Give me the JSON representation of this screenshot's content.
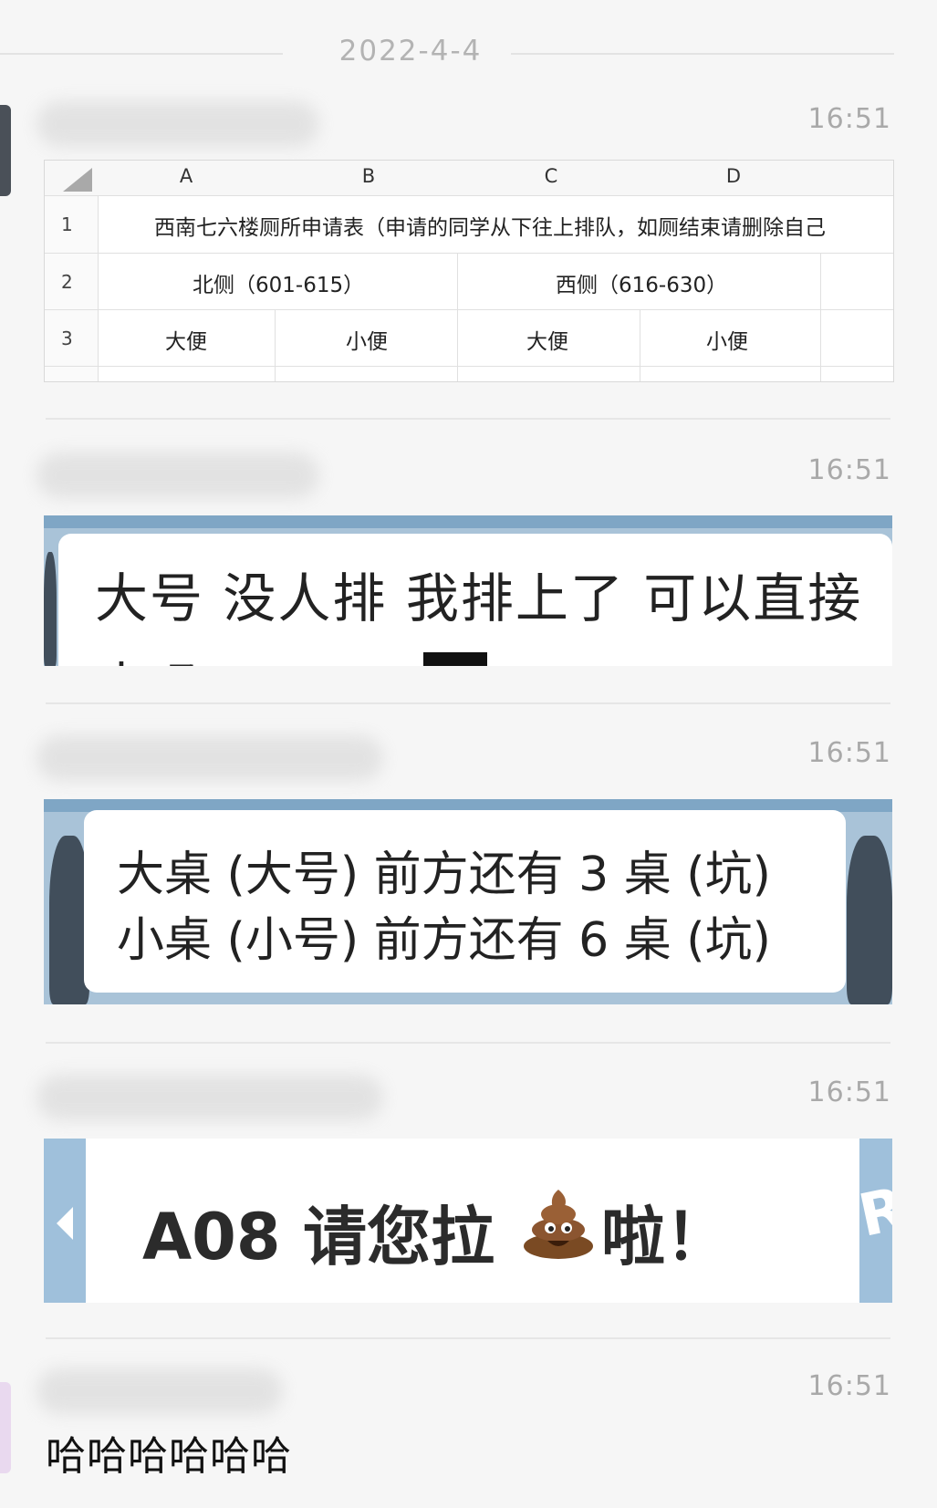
{
  "chat": {
    "date": "2022-4-4",
    "messages": [
      {
        "time": "16:51",
        "type": "image-spreadsheet"
      },
      {
        "time": "16:51",
        "type": "image-screenshot"
      },
      {
        "time": "16:51",
        "type": "image-screenshot"
      },
      {
        "time": "16:51",
        "type": "image-screenshot"
      },
      {
        "time": "16:51",
        "type": "text",
        "text": "哈哈哈哈哈哈"
      }
    ]
  },
  "spreadsheet": {
    "columns": [
      "A",
      "B",
      "C",
      "D"
    ],
    "row_numbers": [
      "1",
      "2",
      "3"
    ],
    "row1": "西南七六楼厕所申请表（申请的同学从下往上排队，如厕结束请删除自己",
    "row2": [
      "北侧（601-615）",
      "西侧（616-630）"
    ],
    "row3": [
      "大便",
      "小便",
      "大便",
      "小便"
    ]
  },
  "screenshot1": {
    "line1": "大号 没人排 我排上了 可以直接",
    "line2_partial": "去吗 @"
  },
  "screenshot2": {
    "line1": "大桌 (大号)  前方还有 3 桌 (坑)",
    "line2": "小桌 (小号)  前方还有 6 桌 (坑)"
  },
  "screenshot3": {
    "text_before": "A08 请您拉",
    "emoji": "poop-icon",
    "text_after": "啦！",
    "side_letters": "RE"
  },
  "colors": {
    "background": "#f6f6f6",
    "time_gray": "#a9a9a9",
    "screenshot_blue": "#a9c3d8"
  }
}
